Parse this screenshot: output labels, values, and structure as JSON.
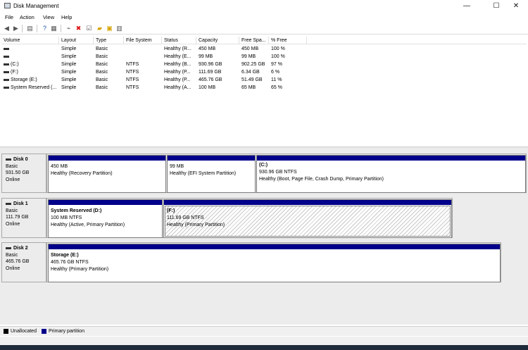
{
  "window": {
    "title": "Disk Management"
  },
  "window_controls": {
    "minimize": "—",
    "maximize": "☐",
    "close": "✕"
  },
  "menu": [
    "File",
    "Action",
    "View",
    "Help"
  ],
  "toolbar_icons": [
    "back-icon",
    "forward-icon",
    "disk-list-icon",
    "help-icon",
    "properties-icon",
    "connect-icon",
    "delete-icon",
    "check-icon",
    "folder-icon",
    "rescan-icon",
    "list-view-icon"
  ],
  "volume_table": {
    "columns": [
      "Volume",
      "Layout",
      "Type",
      "File System",
      "Status",
      "Capacity",
      "Free Spa...",
      "% Free"
    ],
    "rows": [
      [
        "",
        "Simple",
        "Basic",
        "",
        "Healthy (R...",
        "450 MB",
        "450 MB",
        "100 %"
      ],
      [
        "",
        "Simple",
        "Basic",
        "",
        "Healthy (E...",
        "99 MB",
        "99 MB",
        "100 %"
      ],
      [
        "(C:)",
        "Simple",
        "Basic",
        "NTFS",
        "Healthy (B...",
        "930.96 GB",
        "902.25 GB",
        "97 %"
      ],
      [
        "(F:)",
        "Simple",
        "Basic",
        "NTFS",
        "Healthy (P...",
        "111.69 GB",
        "6.34 GB",
        "6 %"
      ],
      [
        "Storage (E:)",
        "Simple",
        "Basic",
        "NTFS",
        "Healthy (P...",
        "465.76 GB",
        "51.49 GB",
        "11 %"
      ],
      [
        "System Reserved (...",
        "Simple",
        "Basic",
        "NTFS",
        "Healthy (A...",
        "100 MB",
        "65 MB",
        "65 %"
      ]
    ]
  },
  "disks": [
    {
      "name": "Disk 0",
      "type": "Basic",
      "size": "931.50 GB",
      "state": "Online",
      "partitions": [
        {
          "name": "",
          "size": "450 MB",
          "status": "Healthy (Recovery Partition)"
        },
        {
          "name": "",
          "size": "99 MB",
          "status": "Healthy (EFI System Partition)"
        },
        {
          "name": "(C:)",
          "size": "930.96 GB NTFS",
          "status": "Healthy (Boot, Page File, Crash Dump, Primary Partition)"
        }
      ]
    },
    {
      "name": "Disk 1",
      "type": "Basic",
      "size": "111.79 GB",
      "state": "Online",
      "partitions": [
        {
          "name": "System Reserved  (D:)",
          "size": "100 MB NTFS",
          "status": "Healthy (Active, Primary Partition)"
        },
        {
          "name": "(F:)",
          "size": "111.69 GB NTFS",
          "status": "Healthy (Primary Partition)"
        }
      ]
    },
    {
      "name": "Disk 2",
      "type": "Basic",
      "size": "465.76 GB",
      "state": "Online",
      "partitions": [
        {
          "name": "Storage  (E:)",
          "size": "465.76 GB NTFS",
          "status": "Healthy (Primary Partition)"
        }
      ]
    }
  ],
  "legend": [
    {
      "label": "Unallocated",
      "color": "#000000"
    },
    {
      "label": "Primary partition",
      "color": "#00008b"
    }
  ]
}
